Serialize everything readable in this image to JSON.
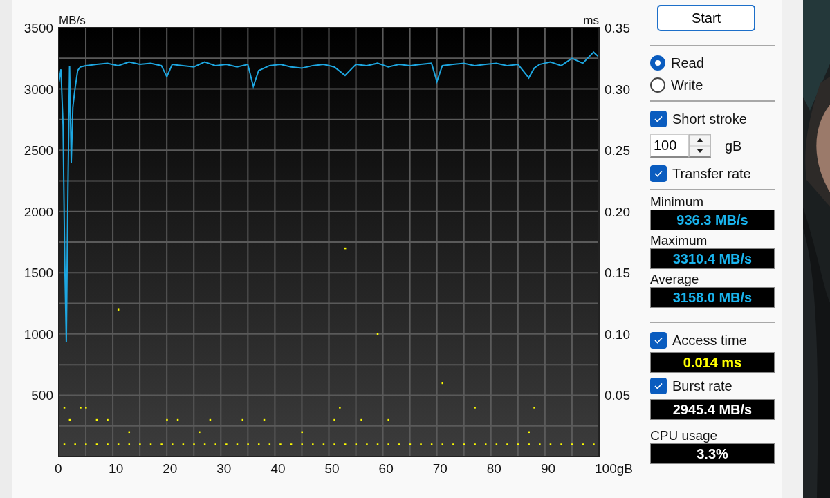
{
  "chart": {
    "chart_data": {
      "type": "line",
      "ylabel": "MB/s",
      "xlim": [
        0,
        100
      ],
      "ylim": [
        0,
        3500
      ],
      "grid": true,
      "xticks": [
        0,
        10,
        20,
        30,
        40,
        50,
        60,
        70,
        80,
        90,
        {
          "value": 100,
          "label": "100gB"
        }
      ],
      "yticks": [
        500,
        1000,
        1500,
        2000,
        2500,
        3000,
        3500
      ],
      "series": [
        {
          "color": "#1ea7e1",
          "x": [
            0,
            0.4,
            0.8,
            1.1,
            1.4,
            1.7,
            2,
            2.3,
            2.6,
            3,
            3.5,
            4,
            5,
            7,
            9,
            11,
            13,
            15,
            17,
            19,
            20,
            21,
            23,
            25,
            27,
            29,
            31,
            33,
            35,
            36,
            37,
            39,
            41,
            43,
            45,
            47,
            49,
            51,
            53,
            55,
            57,
            59,
            61,
            63,
            65,
            67,
            69,
            70,
            71,
            73,
            75,
            77,
            79,
            81,
            83,
            85,
            87,
            88,
            89,
            91,
            93,
            95,
            97,
            99,
            100
          ],
          "values": [
            3050,
            3160,
            2700,
            1600,
            936,
            2200,
            3190,
            2400,
            2850,
            3000,
            3150,
            3180,
            3190,
            3200,
            3210,
            3190,
            3220,
            3200,
            3210,
            3190,
            3100,
            3200,
            3190,
            3180,
            3220,
            3190,
            3200,
            3180,
            3200,
            3020,
            3150,
            3190,
            3200,
            3180,
            3170,
            3190,
            3200,
            3180,
            3110,
            3200,
            3190,
            3210,
            3180,
            3200,
            3190,
            3200,
            3210,
            3060,
            3190,
            3200,
            3210,
            3190,
            3200,
            3210,
            3190,
            3200,
            3090,
            3170,
            3200,
            3220,
            3190,
            3250,
            3210,
            3300,
            3260
          ]
        }
      ]
    }
  },
  "access_chart": {
    "chart_data": {
      "type": "scatter",
      "ylabel": "ms",
      "xlim": [
        0,
        100
      ],
      "ylim": [
        0,
        0.35
      ],
      "yticks": [
        {
          "value": 0.05,
          "label": "0.05"
        },
        {
          "value": 0.1,
          "label": "0.10"
        },
        {
          "value": 0.15,
          "label": "0.15"
        },
        {
          "value": 0.2,
          "label": "0.20"
        },
        {
          "value": 0.25,
          "label": "0.25"
        },
        {
          "value": 0.3,
          "label": "0.30"
        },
        {
          "value": 0.35,
          "label": "0.35"
        }
      ],
      "series": [
        {
          "color": "#ffff00",
          "x": [
            1,
            3,
            5,
            7,
            9,
            11,
            13,
            15,
            17,
            19,
            21,
            23,
            25,
            27,
            29,
            31,
            33,
            35,
            37,
            39,
            41,
            43,
            45,
            47,
            49,
            51,
            53,
            55,
            57,
            59,
            61,
            63,
            65,
            67,
            69,
            71,
            73,
            75,
            77,
            79,
            81,
            83,
            85,
            87,
            89,
            91,
            93,
            95,
            97,
            99,
            1,
            2,
            4,
            5,
            7,
            9,
            11,
            13,
            20,
            22,
            26,
            28,
            34,
            38,
            45,
            51,
            52,
            53,
            56,
            59,
            61,
            71,
            77,
            87,
            88
          ],
          "values": [
            0.01,
            0.01,
            0.01,
            0.01,
            0.01,
            0.01,
            0.01,
            0.01,
            0.01,
            0.01,
            0.01,
            0.01,
            0.01,
            0.01,
            0.01,
            0.01,
            0.01,
            0.01,
            0.01,
            0.01,
            0.01,
            0.01,
            0.01,
            0.01,
            0.01,
            0.01,
            0.01,
            0.01,
            0.01,
            0.01,
            0.01,
            0.01,
            0.01,
            0.01,
            0.01,
            0.01,
            0.01,
            0.01,
            0.01,
            0.01,
            0.01,
            0.01,
            0.01,
            0.01,
            0.01,
            0.01,
            0.01,
            0.01,
            0.01,
            0.01,
            0.04,
            0.03,
            0.04,
            0.04,
            0.03,
            0.03,
            0.12,
            0.02,
            0.03,
            0.03,
            0.02,
            0.03,
            0.03,
            0.03,
            0.02,
            0.03,
            0.04,
            0.17,
            0.03,
            0.1,
            0.03,
            0.06,
            0.04,
            0.02,
            0.04
          ]
        }
      ]
    }
  },
  "start_button": "Start",
  "mode": [
    {
      "label": "Read",
      "selected": true
    },
    {
      "label": "Write",
      "selected": false
    }
  ],
  "short_stroke": {
    "label": "Short stroke",
    "checked": true,
    "value": "100",
    "unit": "gB"
  },
  "transfer_rate": {
    "label": "Transfer rate",
    "checked": true,
    "stats": [
      {
        "label": "Minimum",
        "value": "936.3 MB/s"
      },
      {
        "label": "Maximum",
        "value": "3310.4 MB/s"
      },
      {
        "label": "Average",
        "value": "3158.0 MB/s"
      }
    ]
  },
  "access_time": {
    "label": "Access time",
    "checked": true,
    "value": "0.014 ms"
  },
  "burst_rate": {
    "label": "Burst rate",
    "checked": true,
    "value": "2945.4 MB/s"
  },
  "cpu_usage": {
    "label": "CPU usage",
    "value": "3.3%"
  }
}
